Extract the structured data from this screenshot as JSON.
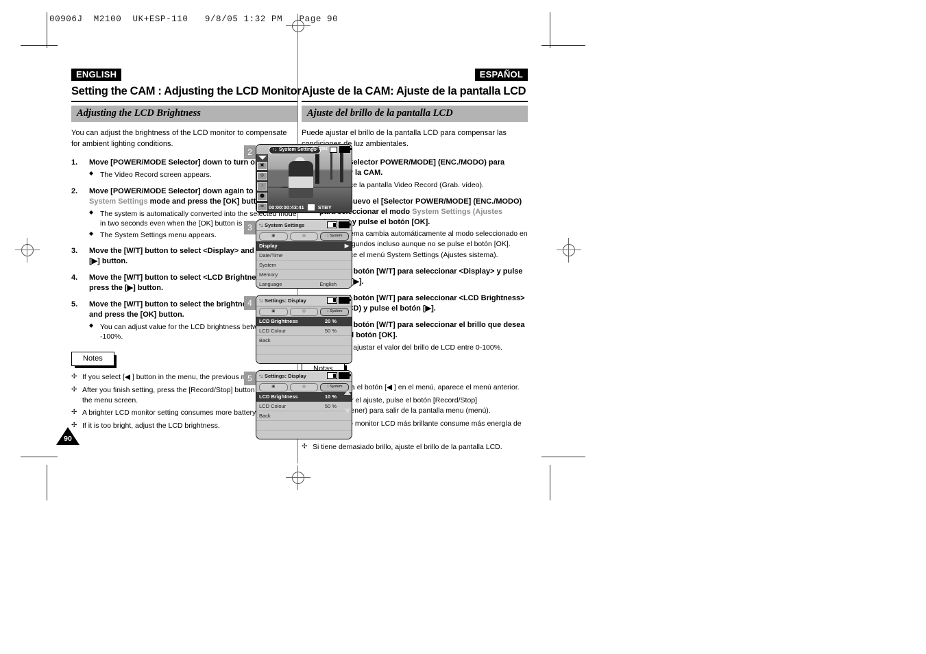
{
  "print_slug": "00906J  M2100  UK+ESP-110   9/8/05 1:32 PM   Page 90",
  "page_number": "90",
  "english": {
    "lang_tag": "ENGLISH",
    "chapter_title": "Setting the CAM : Adjusting the LCD Monitor",
    "section_title": "Adjusting the LCD Brightness",
    "intro": "You can adjust the brightness of the LCD monitor to compensate for ambient lighting conditions.",
    "steps": [
      {
        "num": "1.",
        "text_parts": [
          "Move [POWER/MODE Selector] down to turn on the CAM."
        ],
        "bullets": [
          "The Video Record screen appears."
        ]
      },
      {
        "num": "2.",
        "pre": "Move [POWER/MODE Selector] down again to select ",
        "grey": "System Settings",
        "post": " mode and press the [OK] button.",
        "bullets": [
          "The system is automatically converted into the selected mode in two seconds even when the [OK] button is not pressed.",
          "The System Settings menu appears."
        ]
      },
      {
        "num": "3.",
        "text_parts": [
          "Move the [W/T] button to select <Display> and press the [▶] button."
        ],
        "bullets": []
      },
      {
        "num": "4.",
        "text_parts": [
          "Move the [W/T] button to select <LCD Brightness> and press the [▶] button."
        ],
        "bullets": []
      },
      {
        "num": "5.",
        "text_parts": [
          "Move the [W/T] button to select the brightness you want and press the [OK] button."
        ],
        "bullets": [
          "You can adjust value for the LCD brightness between 0 -100%."
        ]
      }
    ],
    "notes_label": "Notes",
    "notes": [
      "If you select [◀ ] button in the menu, the previous menu appears.",
      "After you finish setting, press the [Record/Stop] button to exit from the menu screen.",
      "A brighter LCD monitor setting consumes more battery power.",
      "If it is too bright, adjust the LCD brightness."
    ]
  },
  "spanish": {
    "lang_tag": "ESPAÑOL",
    "chapter_title": "Ajuste de la CAM: Ajuste de la pantalla LCD",
    "section_title": "Ajuste del brillo de la pantalla LCD",
    "intro": "Puede ajustar el brillo de la pantalla LCD para compensar las condiciones de luz ambientales.",
    "steps": [
      {
        "num": "1.",
        "text_parts": [
          "Baje el [Selector POWER/MODE] (ENC./MODO) para encender la CAM."
        ],
        "bullets": [
          "Aparece la pantalla Video Record (Grab. vídeo)."
        ]
      },
      {
        "num": "2.",
        "pre": "Baje de nuevo el [Selector POWER/MODE] (ENC./MODO) para seleccionar el modo ",
        "grey": "System Settings (Ajustes sistema)",
        "post": " y pulse el botón [OK].",
        "bullets": [
          "El sistema cambia automáticamente al modo seleccionado en dos segundos incluso aunque no se pulse el botón [OK].",
          "Aparece el menú System Settings (Ajustes sistema)."
        ]
      },
      {
        "num": "3.",
        "text_parts": [
          "Mueva el botón [W/T] para seleccionar <Display> y pulse el botón [▶]."
        ],
        "bullets": []
      },
      {
        "num": "4.",
        "text_parts": [
          "Mueva el botón [W/T] para seleccionar <LCD Brightness> (Brillo LCD) y pulse el botón [▶]."
        ],
        "bullets": []
      },
      {
        "num": "5.",
        "text_parts": [
          "Mueva el botón [W/T] para seleccionar el brillo que desea y pulse el botón [OK]."
        ],
        "bullets": [
          "Puede ajustar el valor del brillo de LCD entre 0-100%."
        ]
      }
    ],
    "notes_label": "Notas",
    "notes": [
      "Si selecciona el botón [◀ ] en el menú, aparece el menú anterior.",
      "Tras finalizar el ajuste, pulse el botón [Record/Stop] (Grabar/Detener) para salir de la pantalla menu (menú).",
      "Un ajuste de monitor LCD más brillante consume más energía de la batería.",
      "Si tiene demasiado brillo, ajuste el brillo de la pantalla LCD."
    ]
  },
  "screens": [
    {
      "step": "2",
      "type": "video-record",
      "title": "System Settings",
      "fnumber": "F / 7281",
      "timecode": "00:00:00:43:41",
      "status": "STBY",
      "mode_icons": [
        "video-mode-icon",
        "photo-mode-icon",
        "music-mode-icon",
        "voice-mode-icon",
        "file-mode-icon"
      ]
    },
    {
      "step": "3",
      "type": "menu",
      "title": "System Settings",
      "tabs": [
        "tab-record",
        "tab-play",
        "System"
      ],
      "active_tab": 2,
      "rows": [
        {
          "label": "Display",
          "value": "",
          "selected": true,
          "arrow": true
        },
        {
          "label": "Date/Time",
          "value": "",
          "selected": false
        },
        {
          "label": "System",
          "value": "",
          "selected": false
        },
        {
          "label": "Memory",
          "value": "",
          "selected": false
        },
        {
          "label": "Language",
          "value": "English",
          "selected": false
        }
      ]
    },
    {
      "step": "4",
      "type": "menu",
      "title": "Settings: Display",
      "tabs": [
        "tab-record",
        "tab-play",
        "System"
      ],
      "active_tab": 2,
      "rows": [
        {
          "label": "LCD Brightness",
          "value": "20 %",
          "selected": true
        },
        {
          "label": "LCD Colour",
          "value": "50 %",
          "selected": false
        },
        {
          "label": "Back",
          "value": "",
          "selected": false
        },
        {
          "label": "",
          "value": "",
          "selected": false
        },
        {
          "label": "",
          "value": "",
          "selected": false
        },
        {
          "label": "",
          "value": "",
          "selected": false
        }
      ]
    },
    {
      "step": "5",
      "type": "menu",
      "title": "Settings: Display",
      "tabs": [
        "tab-record",
        "tab-play",
        "System"
      ],
      "active_tab": 2,
      "scroll_arrows": true,
      "rows": [
        {
          "label": "LCD Brightness",
          "value": "10 %",
          "selected": true
        },
        {
          "label": "LCD Colour",
          "value": "50 %",
          "selected": false
        },
        {
          "label": "Back",
          "value": "",
          "selected": false
        },
        {
          "label": "",
          "value": "",
          "selected": false
        },
        {
          "label": "",
          "value": "",
          "selected": false
        },
        {
          "label": "",
          "value": "",
          "selected": false
        }
      ]
    }
  ]
}
